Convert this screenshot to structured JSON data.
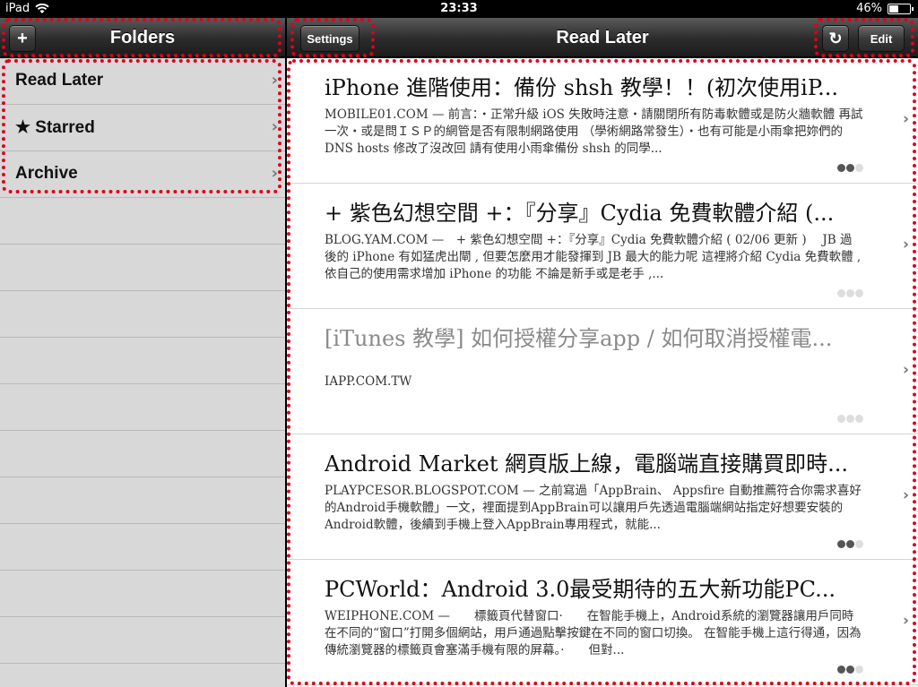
{
  "status_bar": {
    "device": "iPad",
    "time": "23:33",
    "battery": "46%",
    "battery_level": 0.46
  },
  "folders_toolbar": {
    "add_label": "+",
    "title": "Folders"
  },
  "main_toolbar": {
    "settings_label": "Settings",
    "title": "Read Later",
    "refresh_glyph": "↻",
    "edit_label": "Edit"
  },
  "folders": [
    {
      "label": "Read Later"
    },
    {
      "label": "★ Starred"
    },
    {
      "label": "Archive"
    }
  ],
  "articles": [
    {
      "title": "iPhone 進階使用：備份 shsh 教學！！(初次使用iP...",
      "source": "MOBILE01.COM",
      "summary": " — 前言：‧正常升級 iOS 失敗時注意‧請關閉所有防毒軟體或是防火牆軟體 再試一次‧或是問ＩＳＰ的網管是否有限制網路使用 （學術網路常發生）‧也有可能是小雨傘把妳們的DNS hosts 修改了沒改回 請有使用小雨傘備份 shsh 的同學...",
      "read": false,
      "progress_dots": [
        true,
        true,
        false
      ]
    },
    {
      "title": "+ 紫色幻想空間 +：『分享』Cydia 免費軟體介紹 (...",
      "source": "BLOG.YAM.COM",
      "summary": " —　+ 紫色幻想空間 +：『分享』Cydia 免費軟體介紹 ( 02/06 更新 )　 JB 過後的 iPhone 有如猛虎出閘 , 但要怎麼用才能發揮到 JB 最大的能力呢 這裡將介紹 Cydia 免費軟體 , 依自己的使用需求增加 iPhone 的功能 不論是新手或是老手 ,...",
      "read": false,
      "progress_dots": [
        false,
        false,
        false
      ]
    },
    {
      "title": "[iTunes 教學] 如何授權分享app / 如何取消授權電...",
      "source": "IAPP.COM.TW",
      "summary": "",
      "read": true,
      "progress_dots": [
        false,
        false,
        false
      ]
    },
    {
      "title": "Android Market 網頁版上線，電腦端直接購買即時...",
      "source": "PLAYPCESOR.BLOGSPOT.COM",
      "summary": " — 之前寫過「AppBrain、 Appsfire 自動推薦符合你需求喜好的Android手機軟體」一文，裡面提到AppBrain可以讓用戶先透過電腦端網站指定好想要安裝的Android軟體，後續到手機上登入AppBrain專用程式，就能...",
      "read": false,
      "progress_dots": [
        true,
        true,
        false
      ]
    },
    {
      "title": "PCWorld：Android 3.0最受期待的五大新功能PC...",
      "source": "WEIPHONE.COM",
      "summary": " —　　標籤頁代替窗口·　　在智能手機上，Android系統的瀏覽器讓用戶同時在不同的“窗口”打開多個網站，用戶通過點擊按鍵在不同的窗口切換。 在智能手機上這行得通，因為傳統瀏覽器的標籤頁會塞滿手機有限的屏幕。·　　但對...",
      "read": false,
      "progress_dots": [
        true,
        true,
        false
      ]
    }
  ],
  "highlight_color": "#e0001a"
}
